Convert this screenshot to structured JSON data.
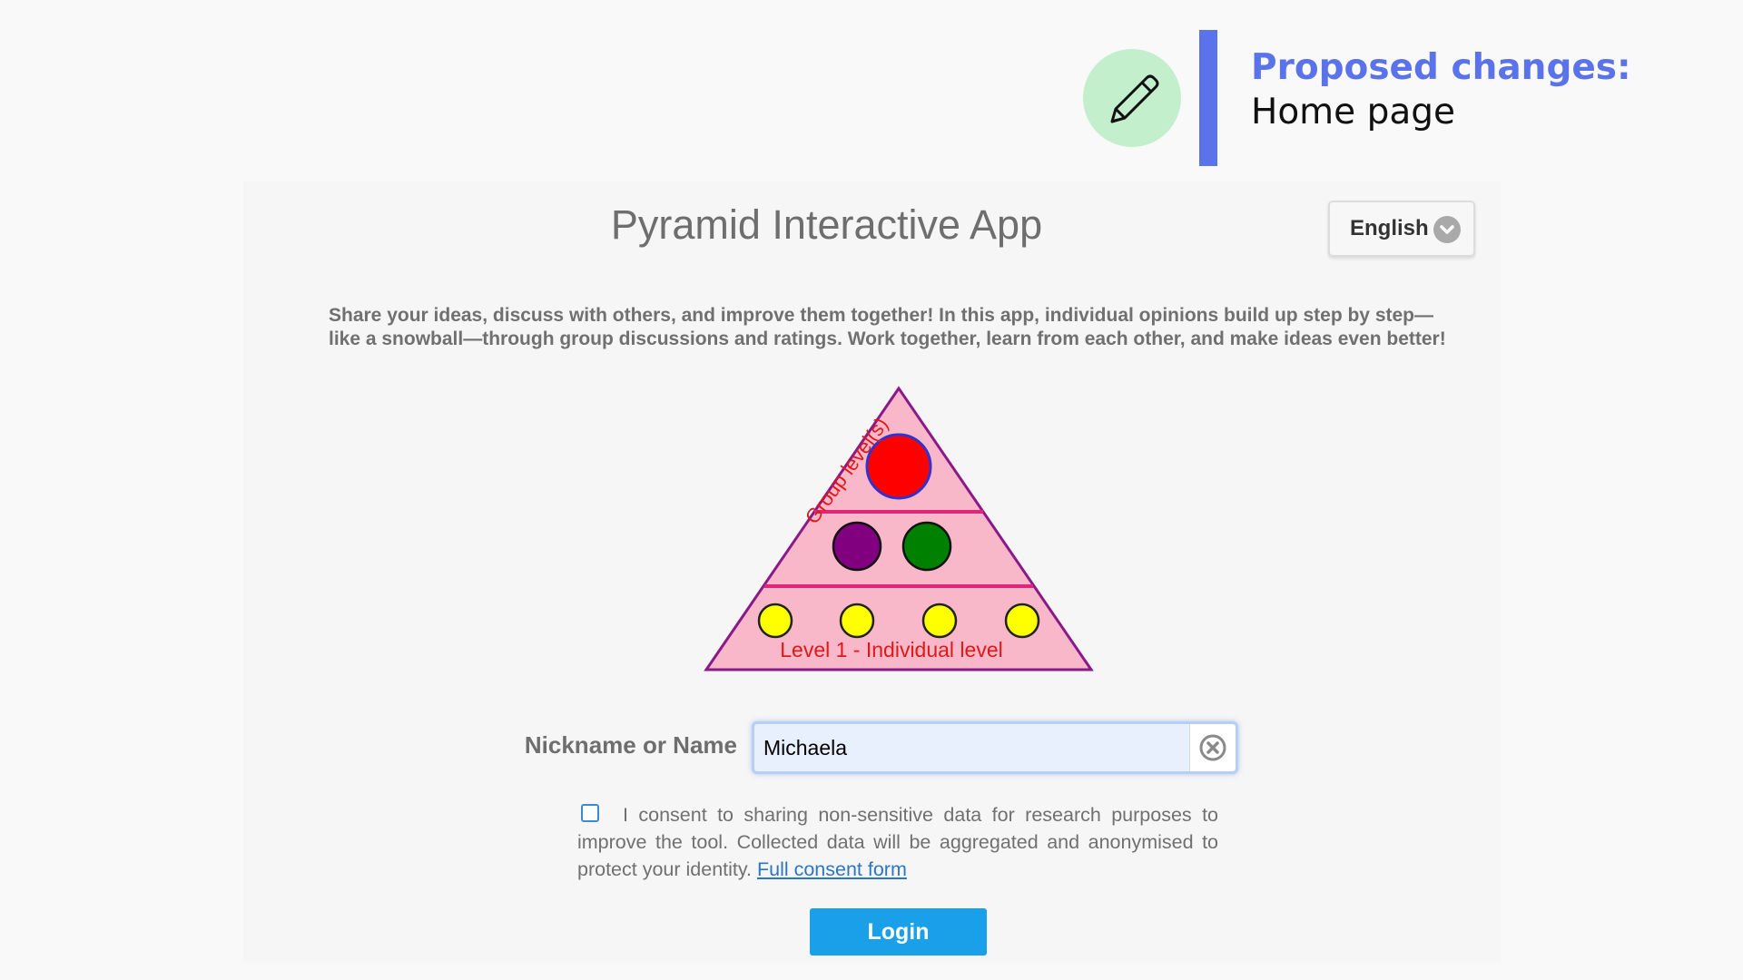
{
  "annotation": {
    "heading_line1": "Proposed changes:",
    "heading_line2": "Home page",
    "icon": "pencil-icon",
    "accent_color": "#5b73ea",
    "icon_bg_color": "#c3efcc"
  },
  "app": {
    "title": "Pyramid Interactive App",
    "language": {
      "selected": "English",
      "icon": "chevron-down-icon"
    },
    "intro": "Share your ideas, discuss with others, and improve them together! In this app, individual opinions build up step by step—like a snowball—through group discussions and ratings. Work together, learn from each other, and make ideas even better!",
    "pyramid": {
      "group_label": "Group level(s)",
      "individual_label": "Level 1 - Individual level",
      "colors": {
        "fill": "#f9b8c9",
        "outline": "#8a1a8a",
        "dividers": "#e0267a",
        "top_node": "#ff0000",
        "mid_nodes": [
          "#800080",
          "#008000"
        ],
        "base_nodes": "#ffff00",
        "label_color": "#e01818"
      }
    },
    "form": {
      "name_label": "Nickname or Name",
      "name_value": "Michaela",
      "clear_icon": "clear-circle-icon",
      "consent_checked": false,
      "consent_text": "I consent to sharing non-sensitive data for research purposes to improve the tool. Collected data will be aggregated and anonymised to protect your identity.",
      "consent_link": "Full consent form",
      "login_label": "Login",
      "login_color": "#1aa0e8"
    }
  }
}
